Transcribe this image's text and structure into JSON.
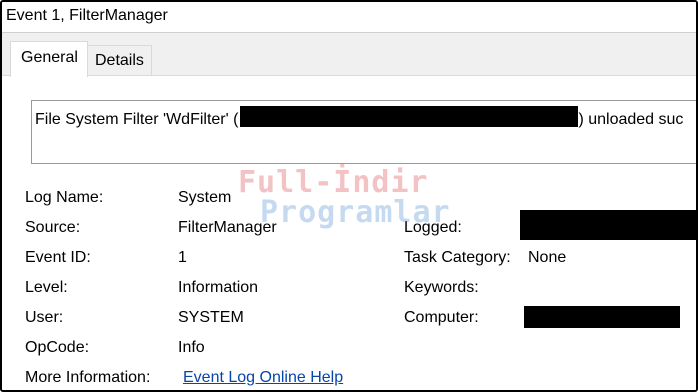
{
  "window": {
    "title": "Event 1, FilterManager"
  },
  "tabs": [
    {
      "label": "General",
      "active": true
    },
    {
      "label": "Details",
      "active": false
    }
  ],
  "description": {
    "prefix": "File System Filter 'WdFilter' (",
    "suffix": ") unloaded suc"
  },
  "fields": {
    "log_name": {
      "label": "Log Name:",
      "value": "System"
    },
    "source": {
      "label": "Source:",
      "value": "FilterManager"
    },
    "event_id": {
      "label": "Event ID:",
      "value": "1"
    },
    "level": {
      "label": "Level:",
      "value": "Information"
    },
    "user": {
      "label": "User:",
      "value": "SYSTEM"
    },
    "opcode": {
      "label": "OpCode:",
      "value": "Info"
    },
    "more_info": {
      "label": "More Information:",
      "link": "Event Log Online Help"
    },
    "logged": {
      "label": "Logged:"
    },
    "task_category": {
      "label": "Task Category:",
      "value": "None"
    },
    "keywords": {
      "label": "Keywords:"
    },
    "computer": {
      "label": "Computer:"
    }
  },
  "watermark": {
    "line1": "Full-İndir",
    "line2": "Programlar"
  },
  "colors": {
    "link": "#0645ad",
    "redaction": "#000000",
    "tab_strip": "#f0f0f0"
  }
}
